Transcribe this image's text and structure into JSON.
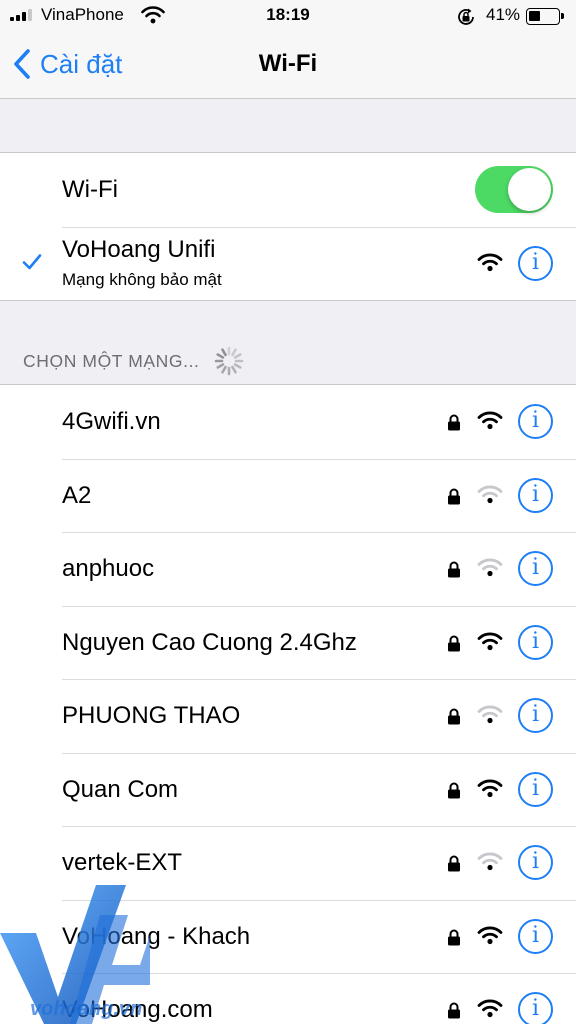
{
  "status_bar": {
    "carrier": "VinaPhone",
    "time": "18:19",
    "battery_percent": "41%",
    "battery_level": 0.41,
    "signal_bars": 3,
    "icons": [
      "signal-icon",
      "wifi-icon",
      "rotation-lock-icon",
      "battery-icon"
    ]
  },
  "nav": {
    "back_label": "Cài đặt",
    "title": "Wi-Fi"
  },
  "wifi_toggle": {
    "label": "Wi-Fi",
    "on": true,
    "color": "#4cd964"
  },
  "connected": {
    "name": "VoHoang Unifi",
    "subtitle": "Mạng không bảo mật",
    "signal": 3
  },
  "section_header": "CHỌN MỘT MẠNG...",
  "networks": [
    {
      "name": "4Gwifi.vn",
      "locked": true,
      "signal": 3
    },
    {
      "name": "A2",
      "locked": true,
      "signal": 1
    },
    {
      "name": "anphuoc",
      "locked": true,
      "signal": 1
    },
    {
      "name": "Nguyen Cao Cuong 2.4Ghz",
      "locked": true,
      "signal": 3
    },
    {
      "name": "PHUONG THAO",
      "locked": true,
      "signal": 1
    },
    {
      "name": "Quan Com",
      "locked": true,
      "signal": 3
    },
    {
      "name": "vertek-EXT",
      "locked": true,
      "signal": 1
    },
    {
      "name": "VoHoang - Khach",
      "locked": true,
      "signal": 3
    },
    {
      "name": "VoHoang.com",
      "locked": true,
      "signal": 3
    }
  ],
  "info_glyph": "i",
  "watermark": "vohoang.vn",
  "colors": {
    "accent": "#1e7ff5",
    "toggle_on": "#4cd964",
    "background": "#efeff4",
    "weak_signal": "#c7c7cc"
  }
}
